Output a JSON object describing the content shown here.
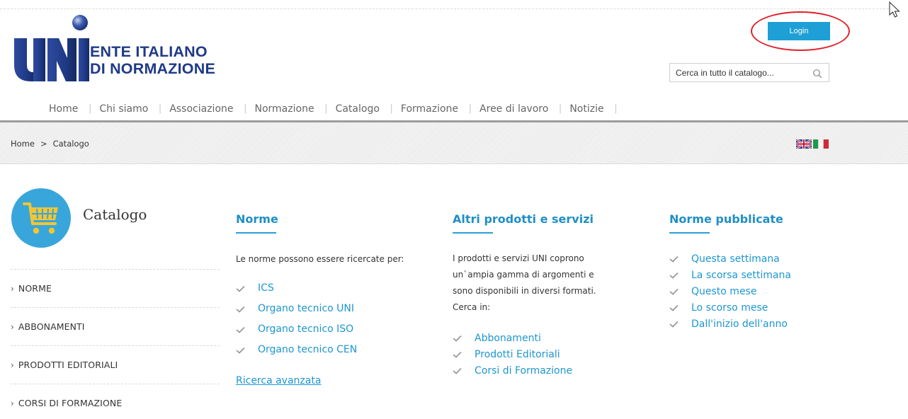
{
  "header": {
    "logo_line1": "ENTE ITALIANO",
    "logo_line2": "DI NORMAZIONE",
    "login_label": "Login",
    "search_placeholder": "Cerca in tutto il catalogo..."
  },
  "nav": {
    "items": [
      "Home",
      "Chi siamo",
      "Associazione",
      "Normazione",
      "Catalogo",
      "Formazione",
      "Aree di lavoro",
      "Notizie"
    ]
  },
  "breadcrumb": {
    "home": "Home",
    "separator": ">",
    "current": "Catalogo"
  },
  "page": {
    "title": "Catalogo"
  },
  "sidebar": {
    "items": [
      "NORME",
      "ABBONAMENTI",
      "PRODOTTI EDITORIALI",
      "CORSI DI FORMAZIONE"
    ]
  },
  "norme": {
    "heading": "Norme",
    "intro": "Le norme possono essere ricercate per:",
    "links": [
      "ICS",
      "Organo tecnico UNI",
      "Organo tecnico ISO",
      "Organo tecnico CEN"
    ],
    "advanced": "Ricerca avanzata"
  },
  "altri": {
    "heading": "Altri prodotti e servizi",
    "intro_lines": [
      "I prodotti e servizi UNI coprono",
      "un`ampia gamma di argomenti e",
      "sono disponibili in diversi formati.",
      "Cerca in:"
    ],
    "links": [
      "Abbonamenti",
      "Prodotti Editoriali",
      "Corsi di Formazione"
    ]
  },
  "pubblicate": {
    "heading": "Norme pubblicate",
    "links": [
      "Questa settimana",
      "La scorsa settimana",
      "Questo mese",
      "Lo scorso mese",
      "Dall'inizio dell'anno"
    ]
  },
  "colors": {
    "brand_navy": "#1f3a86",
    "accent_blue": "#1e9fd6",
    "link_blue": "#1d96cf",
    "highlight_red": "#e0202a"
  },
  "icons": [
    "uni-logo",
    "cursor-icon",
    "search-icon",
    "uk-flag-icon",
    "italy-flag-icon",
    "cart-icon",
    "check-icon",
    "chevron-right-icon"
  ]
}
